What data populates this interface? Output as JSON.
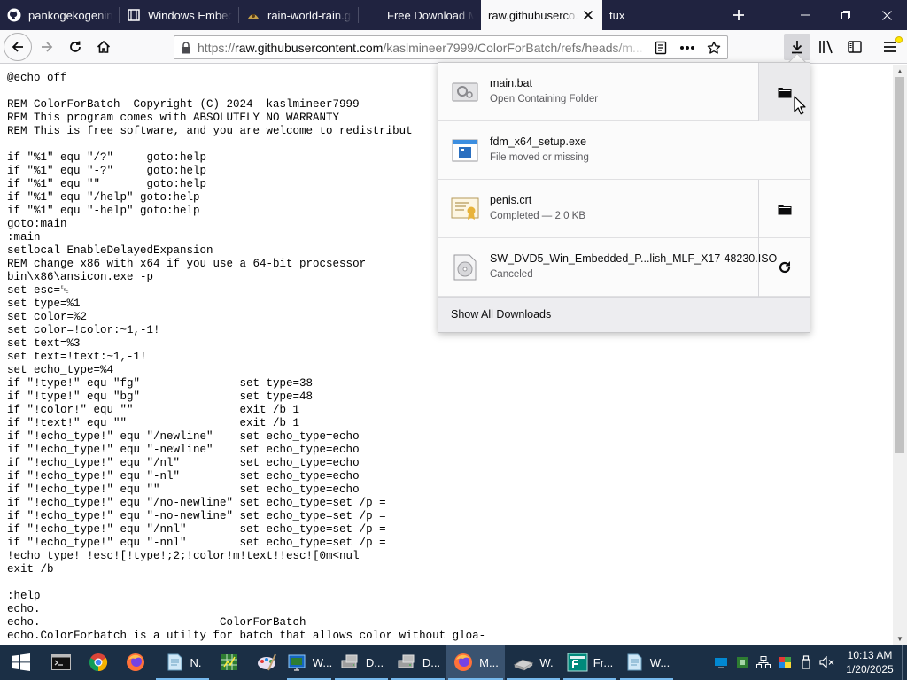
{
  "browser": {
    "tabs": [
      {
        "title": "pankogekogenin...",
        "icon": "github-icon",
        "selected": false
      },
      {
        "title": "Windows Embed...",
        "icon": "page-icon",
        "selected": false
      },
      {
        "title": "rain-world-rain.gi",
        "icon": "rain-world-icon",
        "selected": false
      },
      {
        "title": "Free Download M...",
        "icon": "blank-icon",
        "selected": false
      },
      {
        "title": "raw.githubuserco...",
        "icon": "blank-icon",
        "selected": true
      },
      {
        "title": "tux",
        "icon": "none",
        "selected": false
      }
    ],
    "url": {
      "prefix": "https://",
      "host": "raw.githubusercontent.com",
      "path": "/kaslmineer7999/ColorForBatch/refs/heads/m..."
    }
  },
  "code_lines": [
    "@echo off",
    "",
    "REM ColorForBatch  Copyright (C) 2024  kaslmineer7999",
    "REM This program comes with ABSOLUTELY NO WARRANTY",
    "REM This is free software, and you are welcome to redistribut",
    "",
    "if \"%1\" equ \"/?\"     goto:help",
    "if \"%1\" equ \"-?\"     goto:help",
    "if \"%1\" equ \"\"       goto:help",
    "if \"%1\" equ \"/help\" goto:help",
    "if \"%1\" equ \"-help\" goto:help",
    "goto:main",
    ":main",
    "setlocal EnableDelayedExpansion",
    "REM change x86 with x64 if you use a 64-bit procsessor",
    "bin\\x86\\ansicon.exe -p",
    "set esc=␛",
    "set type=%1",
    "set color=%2",
    "set color=!color:~1,-1!",
    "set text=%3",
    "set text=!text:~1,-1!",
    "set echo_type=%4",
    "if \"!type!\" equ \"fg\"               set type=38",
    "if \"!type!\" equ \"bg\"               set type=48",
    "if \"!color!\" equ \"\"                exit /b 1",
    "if \"!text!\" equ \"\"                 exit /b 1",
    "if \"!echo_type!\" equ \"/newline\"    set echo_type=echo",
    "if \"!echo_type!\" equ \"-newline\"    set echo_type=echo",
    "if \"!echo_type!\" equ \"/nl\"         set echo_type=echo",
    "if \"!echo_type!\" equ \"-nl\"         set echo_type=echo",
    "if \"!echo_type!\" equ \"\"            set echo_type=echo",
    "if \"!echo_type!\" equ \"/no-newline\" set echo_type=set /p =",
    "if \"!echo_type!\" equ \"-no-newline\" set echo_type=set /p =",
    "if \"!echo_type!\" equ \"/nnl\"        set echo_type=set /p =",
    "if \"!echo_type!\" equ \"-nnl\"        set echo_type=set /p =",
    "!echo_type! !esc![!type!;2;!color!m!text!!esc![0m<nul",
    "exit /b",
    "",
    ":help",
    "echo.",
    "echo.                           ColorForBatch",
    "echo.ColorForbatch is a utilty for batch that allows color without gloa-"
  ],
  "downloads": {
    "items": [
      {
        "name": "main.bat",
        "status": "Open Containing Folder",
        "icon": "batch-file-icon",
        "action": "folder-icon"
      },
      {
        "name": "fdm_x64_setup.exe",
        "status": "File moved or missing",
        "icon": "exe-file-icon",
        "action": ""
      },
      {
        "name": "penis.crt",
        "status": "Completed — 2.0 KB",
        "icon": "certificate-file-icon",
        "action": "folder-icon"
      },
      {
        "name": "SW_DVD5_Win_Embedded_P...lish_MLF_X17-48230.ISO",
        "status": "Canceled",
        "icon": "disc-image-icon",
        "action": "retry-icon"
      }
    ],
    "show_all_label": "Show All Downloads"
  },
  "taskbar": {
    "items": [
      {
        "name": "cmd",
        "label": "",
        "icon": "cmd-icon"
      },
      {
        "name": "chrome",
        "label": "",
        "icon": "chrome-icon"
      },
      {
        "name": "firefox",
        "label": "",
        "icon": "firefox-icon"
      },
      {
        "name": "notepad",
        "label": "N.",
        "icon": "notepad-icon"
      },
      {
        "name": "excel",
        "label": "",
        "icon": "spreadsheet-icon"
      },
      {
        "name": "paint",
        "label": "",
        "icon": "paint-icon"
      },
      {
        "name": "vm1",
        "label": "W...",
        "icon": "vm-icon"
      },
      {
        "name": "drive1",
        "label": "D...",
        "icon": "drive-icon"
      },
      {
        "name": "drive2",
        "label": "D...",
        "icon": "drive-icon"
      },
      {
        "name": "firefox-m",
        "label": "M...",
        "icon": "firefox-icon"
      },
      {
        "name": "w-app",
        "label": "W.",
        "icon": "disk-icon"
      },
      {
        "name": "fr-app",
        "label": "Fr...",
        "icon": "fr-app-icon"
      },
      {
        "name": "w-app2",
        "label": "W...",
        "icon": "notepad-icon"
      }
    ],
    "clock": {
      "time": "10:13 AM",
      "date": "1/20/2025"
    }
  },
  "colors": {
    "tabstrip": "#202340",
    "taskbar": "#1b2f45",
    "accent": "#0a84ff"
  }
}
